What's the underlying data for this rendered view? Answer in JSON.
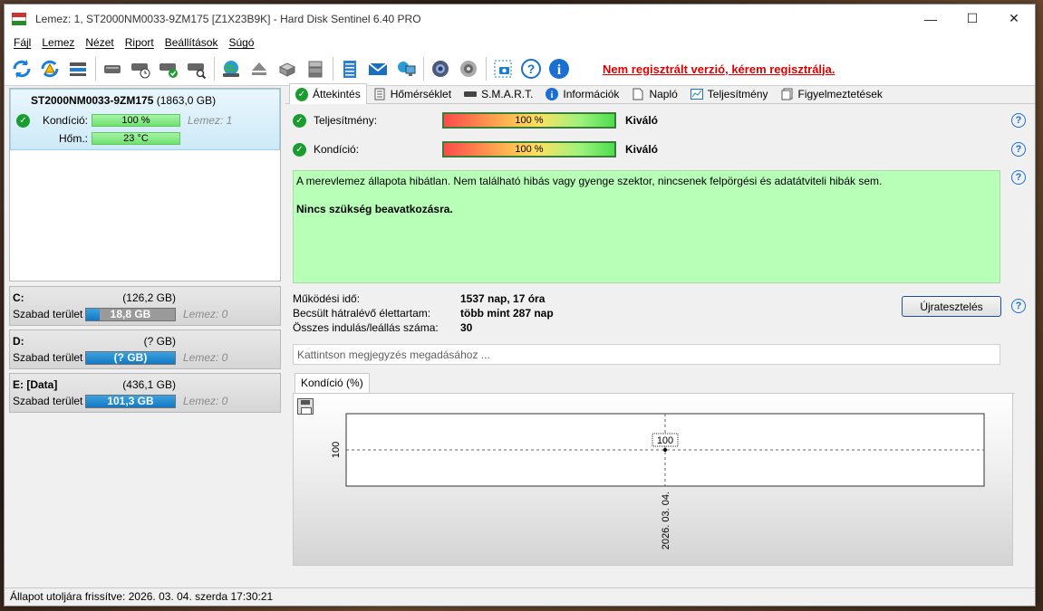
{
  "window": {
    "title": "Lemez: 1, ST2000NM0033-9ZM175 [Z1X23B9K]  -  Hard Disk Sentinel 6.40 PRO",
    "controls": [
      "—",
      "☐",
      "✕"
    ]
  },
  "menu": [
    "Fájl",
    "Lemez",
    "Nézet",
    "Riport",
    "Beállítások",
    "Súgó"
  ],
  "toolbar": {
    "icons": [
      "refresh-icon",
      "refresh-warning-icon",
      "disk-list-icon",
      "disk-icon",
      "disk-clock-icon",
      "disk-check-icon",
      "disk-search-icon",
      "globe-disk-icon",
      "eject-icon",
      "drive-icon",
      "drive-stack-icon",
      "notepad-icon",
      "mail-icon",
      "network-icon",
      "settings-icon",
      "sound-icon",
      "screenshot-icon",
      "help-icon",
      "info-icon"
    ],
    "register_text": "Nem regisztrált verzió, kérem regisztrálja."
  },
  "left_panel": {
    "disk": {
      "name": "ST2000NM0033-9ZM175",
      "size": "(1863,0 GB)",
      "health_label": "Kondíció:",
      "health_value": "100 %",
      "health_disk": "Lemez: 1",
      "temp_label": "Hőm.:",
      "temp_value": "23 °C"
    },
    "volumes": [
      {
        "letter": "C:",
        "size": "(126,2 GB)",
        "free_label": "Szabad terület",
        "free_value": "18,8 GB",
        "free_fraction": 0.15,
        "disk": "Lemez: 0"
      },
      {
        "letter": "D:",
        "size": "(? GB)",
        "free_label": "Szabad terület",
        "free_value": "(? GB)",
        "free_fraction": 1.0,
        "disk": "Lemez: 0"
      },
      {
        "letter": "E: [Data]",
        "size": "(436,1 GB)",
        "free_label": "Szabad terület",
        "free_value": "101,3 GB",
        "free_fraction": 1.0,
        "disk": "Lemez: 0"
      }
    ]
  },
  "tabs": [
    "Áttekintés",
    "Hőmérséklet",
    "S.M.A.R.T.",
    "Információk",
    "Napló",
    "Teljesítmény",
    "Figyelmeztetések"
  ],
  "overview": {
    "performance_label": "Teljesítmény:",
    "performance_value": "100 %",
    "performance_text": "Kiváló",
    "health_label": "Kondíció:",
    "health_value": "100 %",
    "health_text": "Kiváló",
    "description": "A merevlemez állapota hibátlan. Nem található hibás vagy gyenge szektor, nincsenek felpörgési és adatátviteli hibák sem.",
    "recommendation": "Nincs szükség beavatkozásra.",
    "info": [
      {
        "key": "Működési idő:",
        "value": "1537 nap, 17 óra"
      },
      {
        "key": "Becsült hátralévő élettartam:",
        "value": "több mint 287 nap"
      },
      {
        "key": "Összes indulás/leállás száma:",
        "value": "30"
      }
    ],
    "retest_button": "Újratesztelés",
    "note_placeholder": "Kattintson megjegyzés megadásához ...",
    "help_mark": "?"
  },
  "chart_tab": "Kondíció  (%)",
  "chart_data": {
    "type": "line",
    "title": "",
    "x": [
      "2026. 03. 04."
    ],
    "series": [
      {
        "values": [
          100
        ]
      }
    ],
    "ytick": "100",
    "point_label": "100"
  },
  "statusbar": "Állapot utoljára frissítve: 2026. 03. 04. szerda 17:30:21",
  "colors": {
    "accent_green": "#1a9c2e",
    "register_red": "#e00000",
    "desc_bg": "#b8ffb8",
    "volume_bar": "#1577c4"
  }
}
